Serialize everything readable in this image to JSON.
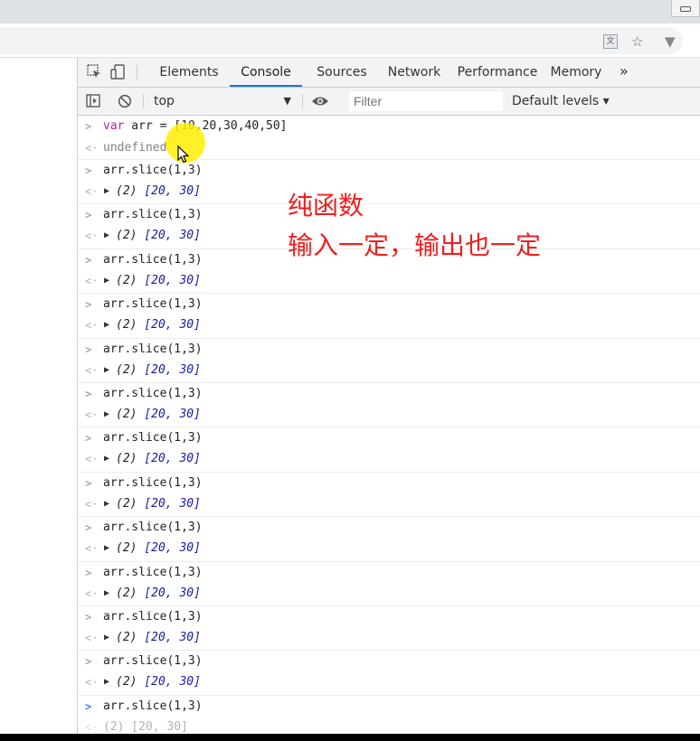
{
  "devtools": {
    "tabs": [
      {
        "label": "Elements"
      },
      {
        "label": "Console"
      },
      {
        "label": "Sources"
      },
      {
        "label": "Network"
      },
      {
        "label": "Performance"
      },
      {
        "label": "Memory"
      }
    ],
    "more_icon": "»",
    "active_tab": "Console"
  },
  "toolbar": {
    "context": "top",
    "filter_placeholder": "Filter",
    "levels": "Default levels ▾"
  },
  "console": {
    "first_input": {
      "keyword": "var",
      "code": " arr = [10,20,30,40,50]"
    },
    "first_output": "undefined",
    "command": "arr.slice(1,3)",
    "result_prefix": "(2) ",
    "result_values": "[20, 30]",
    "result_text": "(2) [20, 30]",
    "repeat_count": 13
  },
  "annotation": {
    "line1": "纯函数",
    "line2": "输入一定，输出也一定"
  },
  "colors": {
    "accent": "#1a73e8",
    "annotation": "#f01e1e",
    "highlight": "#ffee00"
  }
}
